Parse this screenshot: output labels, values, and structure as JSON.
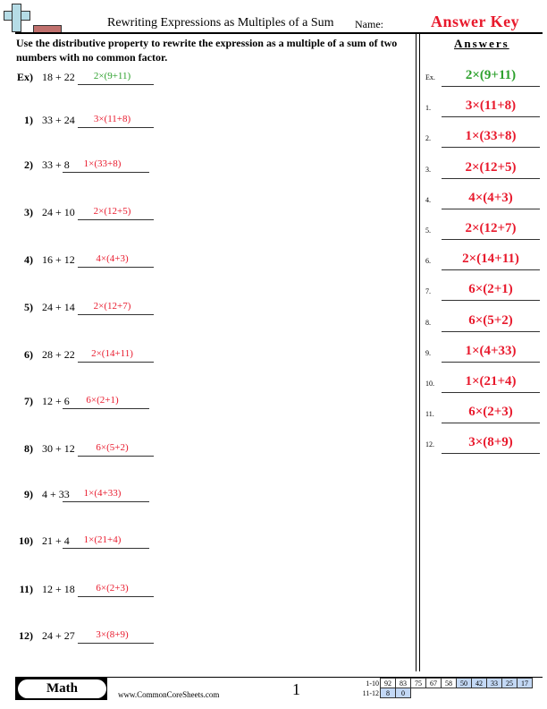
{
  "header": {
    "title": "Rewriting Expressions as Multiples of a Sum",
    "name_label": "Name:",
    "answer_key": "Answer Key"
  },
  "instructions": "Use the distributive property to rewrite the expression as a multiple of a sum of two numbers with no common factor.",
  "colors": {
    "answer_red": "#e8192c",
    "example_green": "#2ca02c",
    "score_shade": "#c3d8f5"
  },
  "problems": [
    {
      "num": "Ex)",
      "expr": "18 + 22",
      "answer": "2×(9+11)"
    },
    {
      "num": "1)",
      "expr": "33 + 24",
      "answer": "3×(11+8)"
    },
    {
      "num": "2)",
      "expr": "33 + 8",
      "answer": "1×(33+8)"
    },
    {
      "num": "3)",
      "expr": "24 + 10",
      "answer": "2×(12+5)"
    },
    {
      "num": "4)",
      "expr": "16 + 12",
      "answer": "4×(4+3)"
    },
    {
      "num": "5)",
      "expr": "24 + 14",
      "answer": "2×(12+7)"
    },
    {
      "num": "6)",
      "expr": "28 + 22",
      "answer": "2×(14+11)"
    },
    {
      "num": "7)",
      "expr": "12 + 6",
      "answer": "6×(2+1)"
    },
    {
      "num": "8)",
      "expr": "30 + 12",
      "answer": "6×(5+2)"
    },
    {
      "num": "9)",
      "expr": "4 + 33",
      "answer": "1×(4+33)"
    },
    {
      "num": "10)",
      "expr": "21 + 4",
      "answer": "1×(21+4)"
    },
    {
      "num": "11)",
      "expr": "12 + 18",
      "answer": "6×(2+3)"
    },
    {
      "num": "12)",
      "expr": "24 + 27",
      "answer": "3×(8+9)"
    }
  ],
  "answers_panel": {
    "title": "Answers",
    "items": [
      {
        "num": "Ex.",
        "answer": "2×(9+11)"
      },
      {
        "num": "1.",
        "answer": "3×(11+8)"
      },
      {
        "num": "2.",
        "answer": "1×(33+8)"
      },
      {
        "num": "3.",
        "answer": "2×(12+5)"
      },
      {
        "num": "4.",
        "answer": "4×(4+3)"
      },
      {
        "num": "5.",
        "answer": "2×(12+7)"
      },
      {
        "num": "6.",
        "answer": "2×(14+11)"
      },
      {
        "num": "7.",
        "answer": "6×(2+1)"
      },
      {
        "num": "8.",
        "answer": "6×(5+2)"
      },
      {
        "num": "9.",
        "answer": "1×(4+33)"
      },
      {
        "num": "10.",
        "answer": "1×(21+4)"
      },
      {
        "num": "11.",
        "answer": "6×(2+3)"
      },
      {
        "num": "12.",
        "answer": "3×(8+9)"
      }
    ]
  },
  "footer": {
    "subject": "Math",
    "site": "www.CommonCoreSheets.com",
    "page": "1",
    "score_rows": [
      {
        "label": "1-10",
        "cells": [
          "92",
          "83",
          "75",
          "67",
          "58",
          "50",
          "42",
          "33",
          "25",
          "17"
        ],
        "shaded_from": 5
      },
      {
        "label": "11-12",
        "cells": [
          "8",
          "0"
        ],
        "shaded_from": 0
      }
    ]
  }
}
